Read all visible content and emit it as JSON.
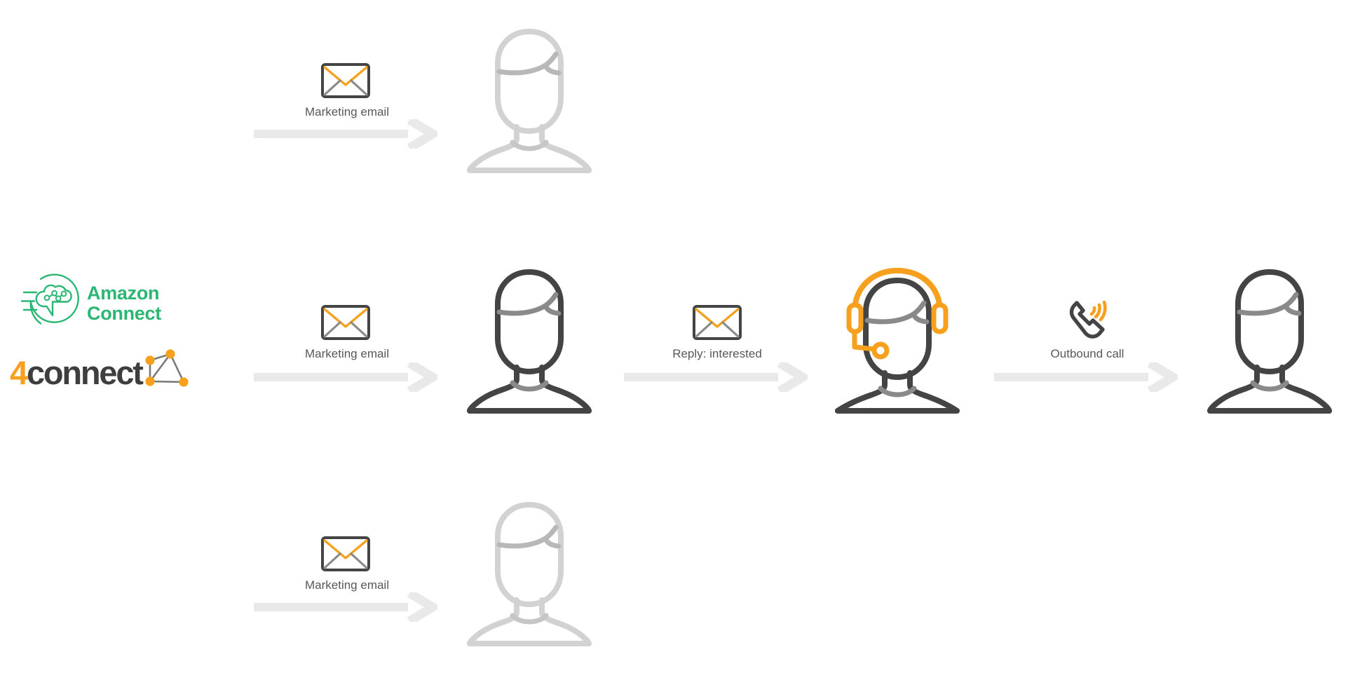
{
  "diagram": {
    "type": "outbound-campaign-flow",
    "title_visible": false,
    "colors": {
      "amazon_green": "#2ab673",
      "brand_orange": "#f7a01d",
      "dark_gray": "#444444",
      "mid_gray": "#8a8a8a",
      "faded_gray": "#d2d2d2",
      "arrow_gray": "#e9e9e9",
      "label_gray": "#58585a",
      "background": "#ffffff"
    }
  },
  "brand": {
    "amazon_connect": {
      "wordmark_line1": "Amazon",
      "wordmark_line2": "Connect",
      "wordmark": "Amazon\nConnect",
      "icon_name": "amazon-connect-cloud-icon"
    },
    "fourconnect": {
      "numeral": "4",
      "word": "connect",
      "icon_name": "network-graph-icon"
    }
  },
  "rows": [
    {
      "id": "row-top",
      "state": "inactive",
      "steps": [
        {
          "icon": "envelope-icon",
          "label": "Marketing email"
        }
      ],
      "recipient": {
        "icon": "person-icon",
        "state": "faded"
      }
    },
    {
      "id": "row-middle",
      "state": "active",
      "steps": [
        {
          "icon": "envelope-icon",
          "label": "Marketing email"
        },
        {
          "icon": "envelope-icon",
          "label": "Reply: interested"
        },
        {
          "icon": "phone-outbound-icon",
          "label": "Outbound call"
        }
      ],
      "actors": [
        {
          "icon": "person-icon",
          "state": "active",
          "role": "customer"
        },
        {
          "icon": "agent-headset-icon",
          "state": "active",
          "role": "contact-center-agent"
        },
        {
          "icon": "person-icon",
          "state": "active",
          "role": "customer"
        }
      ]
    },
    {
      "id": "row-bottom",
      "state": "inactive",
      "steps": [
        {
          "icon": "envelope-icon",
          "label": "Marketing email"
        }
      ],
      "recipient": {
        "icon": "person-icon",
        "state": "faded"
      }
    }
  ],
  "labels": {
    "marketing_email": "Marketing email",
    "reply_interested": "Reply: interested",
    "outbound_call": "Outbound call"
  }
}
